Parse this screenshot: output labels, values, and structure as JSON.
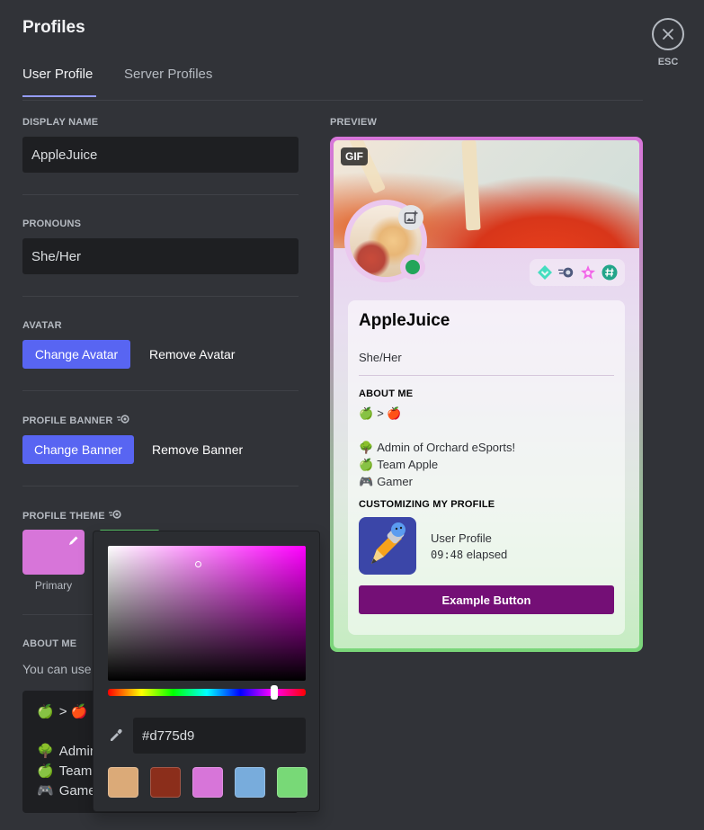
{
  "page": {
    "title": "Profiles"
  },
  "close": {
    "label": "ESC",
    "icon": "close-icon"
  },
  "tabs": [
    {
      "label": "User Profile",
      "active": true
    },
    {
      "label": "Server Profiles",
      "active": false
    }
  ],
  "form": {
    "display_name": {
      "label": "DISPLAY NAME",
      "value": "AppleJuice"
    },
    "pronouns": {
      "label": "PRONOUNS",
      "value": "She/Her"
    },
    "avatar": {
      "label": "AVATAR",
      "change_label": "Change Avatar",
      "remove_label": "Remove Avatar"
    },
    "banner": {
      "label": "PROFILE BANNER",
      "badge_icon": "nitro-icon",
      "change_label": "Change Banner",
      "remove_label": "Remove Banner"
    },
    "theme": {
      "label": "PROFILE THEME",
      "badge_icon": "nitro-icon",
      "primary": {
        "caption": "Primary",
        "color": "#d775d9"
      },
      "secondary": {
        "color": "#7ad679"
      }
    },
    "about_me": {
      "label": "ABOUT ME",
      "description": "You can use markdown and links if you'd like.",
      "lines": [
        {
          "emoji": "🍏",
          "text": "> 🍎"
        },
        {
          "emoji": "",
          "text": ""
        },
        {
          "emoji": "🌳",
          "text": "Admin of Orchard eSports!"
        },
        {
          "emoji": "🍏",
          "text": "Team Apple"
        },
        {
          "emoji": "🎮",
          "text": "Gamer"
        }
      ]
    }
  },
  "color_picker": {
    "hex_value": "#d775d9",
    "hue_degrees": 300,
    "saturation": 0.46,
    "brightness": 0.85,
    "eyedropper_icon": "eyedropper-icon",
    "presets": [
      "#dbaa78",
      "#8b2e1b",
      "#d775d9",
      "#78acdc",
      "#78d977"
    ]
  },
  "preview": {
    "label": "PREVIEW",
    "gif_badge": "GIF",
    "name": "AppleJuice",
    "pronouns": "She/Her",
    "status": "online",
    "badges": [
      "hypesquad-balance-icon",
      "nitro-boost-icon",
      "quest-star-icon",
      "active-developer-icon"
    ],
    "about_heading": "ABOUT ME",
    "about_lines": [
      {
        "emoji": "🍏",
        "text": "> 🍎"
      },
      {
        "emoji": "",
        "text": ""
      },
      {
        "emoji": "🌳",
        "text": "Admin of Orchard eSports!"
      },
      {
        "emoji": "🍏",
        "text": "Team Apple"
      },
      {
        "emoji": "🎮",
        "text": "Gamer"
      }
    ],
    "activity_heading": "CUSTOMIZING MY PROFILE",
    "activity_name": "User Profile",
    "activity_time": "09:48",
    "activity_suffix": "elapsed",
    "button_label": "Example Button",
    "button_color": "#740f76"
  }
}
